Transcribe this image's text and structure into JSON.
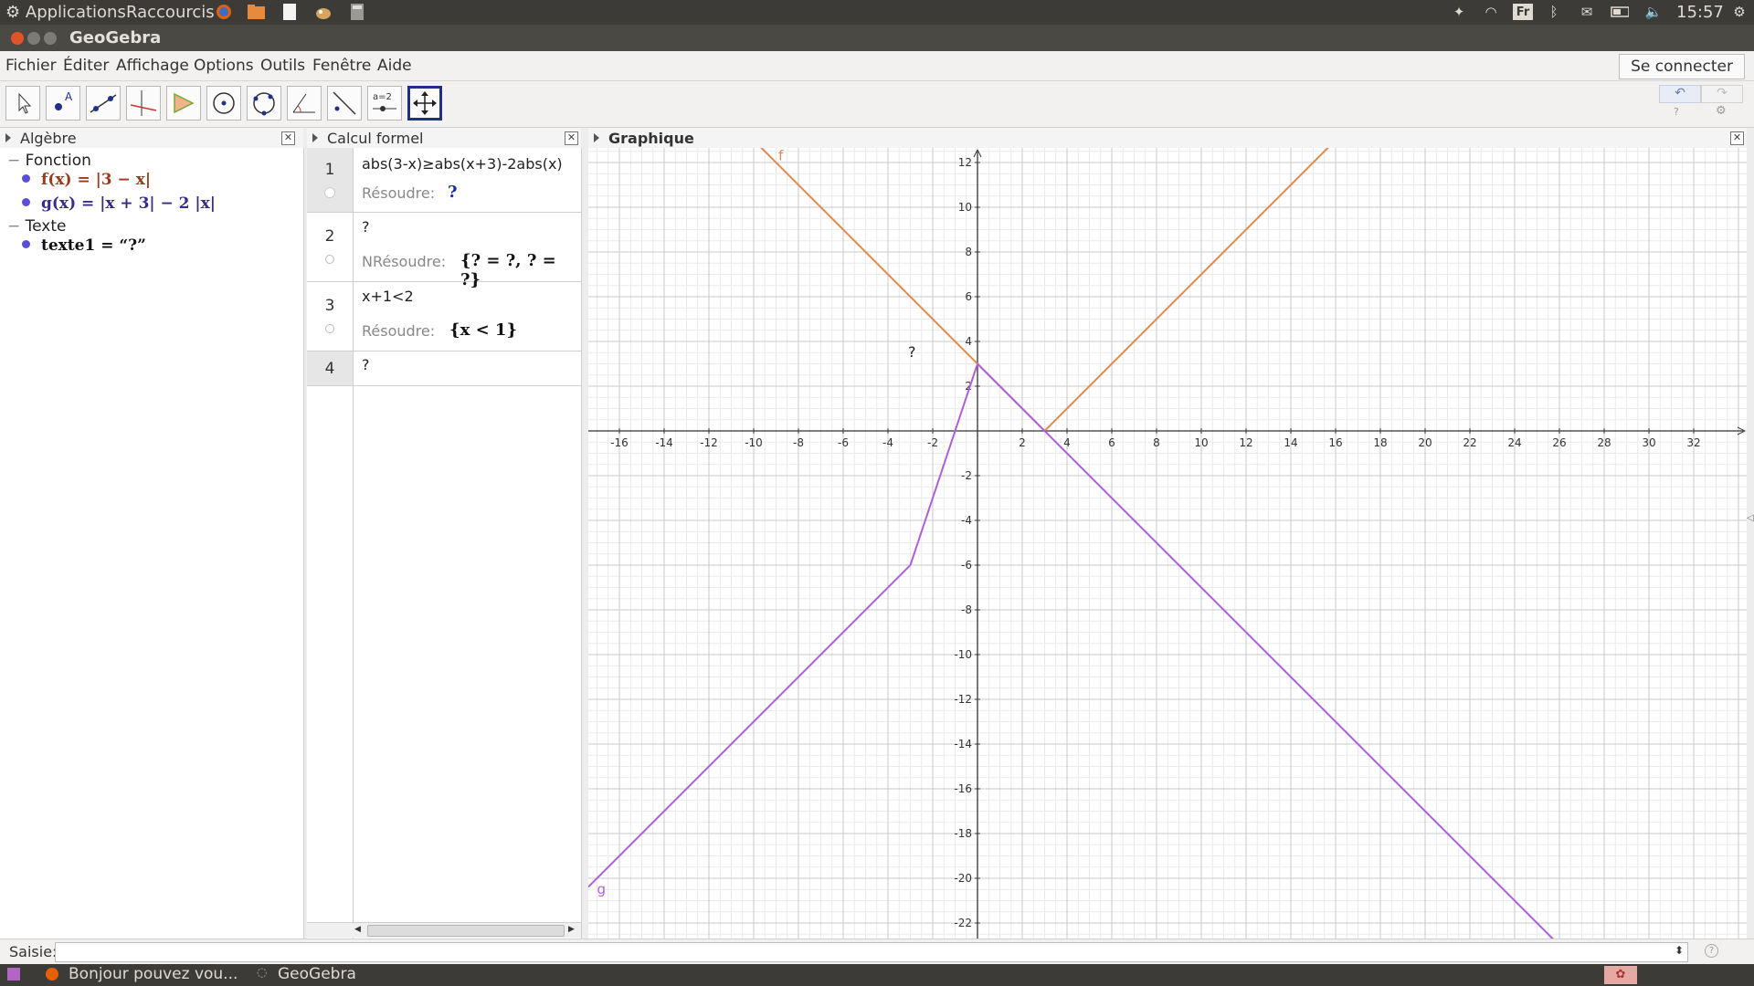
{
  "top_panel": {
    "applications": "Applications",
    "shortcuts": "Raccourcis",
    "lang": "Fr",
    "clock": "15:57"
  },
  "window": {
    "title": "GeoGebra"
  },
  "menu": {
    "items": [
      "Fichier",
      "Éditer",
      "Affichage",
      "Options",
      "Outils",
      "Fenêtre",
      "Aide"
    ],
    "connect": "Se connecter"
  },
  "algebra": {
    "title": "Algèbre",
    "categories": [
      "Fonction",
      "Texte"
    ],
    "f": "f(x) = |3 − x|",
    "g": "g(x) = |x + 3| − 2 |x|",
    "text1": "texte1 = “?”"
  },
  "cas": {
    "title": "Calcul formel",
    "rows": [
      {
        "num": "1",
        "input": "abs(3-x)≥abs(x+3)-2abs(x)",
        "out_label": "Résoudre:",
        "output": "?"
      },
      {
        "num": "2",
        "input": "?",
        "out_label": "NRésoudre:",
        "output": "{? = ?, ? = ?}"
      },
      {
        "num": "3",
        "input": "x+1<2",
        "out_label": "Résoudre:",
        "output": "{x < 1}"
      },
      {
        "num": "4",
        "input": "?",
        "out_label": "",
        "output": ""
      }
    ]
  },
  "graphics": {
    "title": "Graphique",
    "text_label": "?",
    "f_label": "f",
    "g_label": "g",
    "f_color": "#e08a4f",
    "g_color": "#b05ed8",
    "x_ticks": [
      -16,
      -14,
      -12,
      -10,
      -8,
      -6,
      -4,
      -2,
      2,
      4,
      6,
      8,
      10,
      12,
      14,
      16,
      18,
      20,
      22,
      24,
      26,
      28,
      30,
      32
    ],
    "y_ticks": [
      12,
      10,
      8,
      6,
      4,
      2,
      -2,
      -4,
      -6,
      -8,
      -10,
      -12,
      -14,
      -16,
      -18,
      -20,
      -22
    ]
  },
  "input_bar": {
    "label": "Saisie:"
  },
  "taskbar": {
    "items": [
      "Bonjour pouvez vou...",
      "GeoGebra"
    ]
  }
}
